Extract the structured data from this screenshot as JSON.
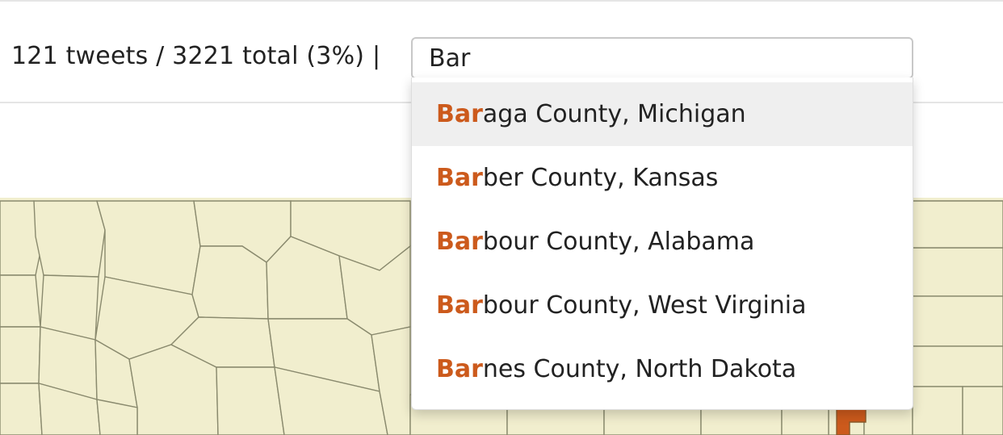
{
  "status": {
    "text": "121 tweets / 3221 total (3%) | "
  },
  "search": {
    "value": "Bar"
  },
  "suggestions": [
    {
      "match": "Bar",
      "rest": "aga County, Michigan",
      "highlight": true
    },
    {
      "match": "Bar",
      "rest": "ber County, Kansas",
      "highlight": false
    },
    {
      "match": "Bar",
      "rest": "bour County, Alabama",
      "highlight": false
    },
    {
      "match": "Bar",
      "rest": "bour County, West Virginia",
      "highlight": false
    },
    {
      "match": "Bar",
      "rest": "nes County, North Dakota",
      "highlight": false
    }
  ],
  "colors": {
    "highlight_match": "#cc5a1c",
    "map_fill": "#f1eece",
    "map_stroke": "#8a8a6e",
    "map_selected": "#cc5a1c"
  }
}
